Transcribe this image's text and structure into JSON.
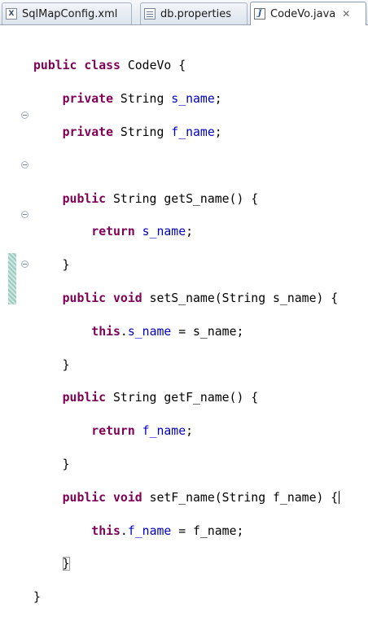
{
  "tabs": [
    {
      "label": "SqlMapConfig.xml",
      "icon": "xml-file-icon",
      "active": false
    },
    {
      "label": "db.properties",
      "icon": "properties-file-icon",
      "active": false
    },
    {
      "label": "CodeVo.java",
      "icon": "java-file-icon",
      "active": true,
      "close": "✕"
    }
  ],
  "code": {
    "class_decl": {
      "kw1": "public",
      "kw2": "class",
      "rest": "CodeVo {"
    },
    "field1": {
      "kw": "private",
      "type": "String",
      "name": "s_name",
      "end": ";"
    },
    "field2": {
      "kw": "private",
      "type": "String",
      "name": "f_name",
      "end": ";"
    },
    "getS": {
      "kw": "public",
      "rest": "String getS_name() {"
    },
    "getS_ret": {
      "kw": "return",
      "name": "s_name",
      "end": ";"
    },
    "setS": {
      "kw1": "public",
      "kw2": "void",
      "rest": "setS_name(String s_name) {"
    },
    "setS_body": {
      "kw": "this",
      "dot": ".",
      "name": "s_name",
      "rest": " = s_name;"
    },
    "getF": {
      "kw": "public",
      "rest": "String getF_name() {"
    },
    "getF_ret": {
      "kw": "return",
      "name": "f_name",
      "end": ";"
    },
    "setF": {
      "kw1": "public",
      "kw2": "void",
      "rest": "setF_name(String f_name) {"
    },
    "setF_body": {
      "kw": "this",
      "dot": ".",
      "name": "f_name",
      "rest": " = f_name;"
    },
    "close_brace": "}"
  },
  "colors": {
    "keyword": "#7f0055",
    "field": "#0000c0",
    "plain": "#000000"
  }
}
